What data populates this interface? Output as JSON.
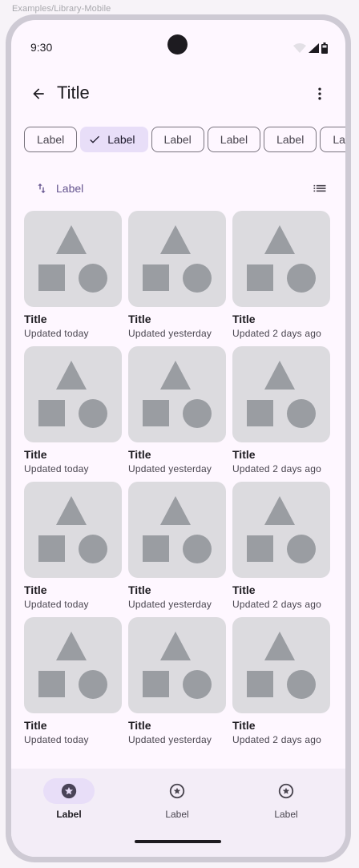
{
  "caption": "Examples/Library-Mobile",
  "status_bar": {
    "time": "9:30"
  },
  "app_bar": {
    "title": "Title",
    "back_icon": "arrow-back-icon",
    "menu_icon": "more-vert-icon"
  },
  "chips": [
    {
      "label": "Label",
      "selected": false
    },
    {
      "label": "Label",
      "selected": true
    },
    {
      "label": "Label",
      "selected": false
    },
    {
      "label": "Label",
      "selected": false
    },
    {
      "label": "Label",
      "selected": false
    },
    {
      "label": "La",
      "selected": false
    }
  ],
  "sort": {
    "label": "Label",
    "icon": "swap-vert-icon"
  },
  "view_toggle_icon": "list-view-icon",
  "cards": [
    {
      "title": "Title",
      "subtitle": "Updated today"
    },
    {
      "title": "Title",
      "subtitle": "Updated yesterday"
    },
    {
      "title": "Title",
      "subtitle": "Updated 2 days ago"
    },
    {
      "title": "Title",
      "subtitle": "Updated today"
    },
    {
      "title": "Title",
      "subtitle": "Updated yesterday"
    },
    {
      "title": "Title",
      "subtitle": "Updated 2 days ago"
    },
    {
      "title": "Title",
      "subtitle": "Updated today"
    },
    {
      "title": "Title",
      "subtitle": "Updated yesterday"
    },
    {
      "title": "Title",
      "subtitle": "Updated 2 days ago"
    },
    {
      "title": "Title",
      "subtitle": "Updated today"
    },
    {
      "title": "Title",
      "subtitle": "Updated yesterday"
    },
    {
      "title": "Title",
      "subtitle": "Updated 2 days ago"
    }
  ],
  "nav": {
    "items": [
      {
        "label": "Label",
        "active": true,
        "icon": "star-circle-icon"
      },
      {
        "label": "Label",
        "active": false,
        "icon": "star-circle-icon"
      },
      {
        "label": "Label",
        "active": false,
        "icon": "star-circle-icon"
      }
    ]
  },
  "colors": {
    "surface": "#FEF7FF",
    "secondary_container": "#E8DEF8",
    "primary": "#65558F",
    "on_surface": "#1D1B20",
    "placeholder_bg": "#DCDBDF",
    "placeholder_shape": "#9A9DA2"
  }
}
